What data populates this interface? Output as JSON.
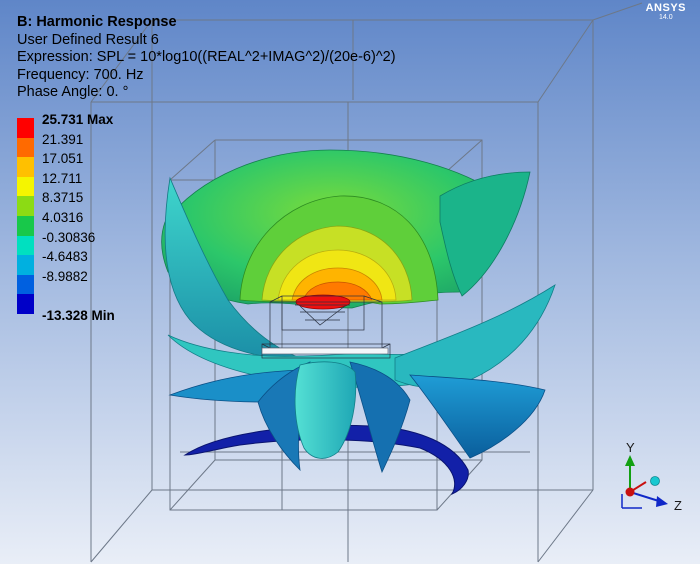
{
  "header": {
    "title": "B: Harmonic Response",
    "result_name": "User Defined Result 6",
    "expression": "Expression: SPL = 10*log10((REAL^2+IMAG^2)/(20e-6)^2)",
    "frequency": "Frequency: 700. Hz",
    "phase_angle": "Phase Angle: 0. °"
  },
  "logo": {
    "brand": "ANSYS",
    "version": "14.0"
  },
  "legend": {
    "max_label": "25.731 Max",
    "min_label": "-13.328 Min",
    "levels": [
      "21.391",
      "17.051",
      "12.711",
      "8.3715",
      "4.0316",
      "-0.30836",
      "-4.6483",
      "-8.9882"
    ],
    "colors": [
      "#ff0000",
      "#ff6a00",
      "#ffc000",
      "#f5f500",
      "#8cdb14",
      "#18c84a",
      "#00e0c0",
      "#00b0e0",
      "#0060e0",
      "#0000c8"
    ]
  },
  "triad": {
    "y_label": "Y",
    "z_label": "Z"
  }
}
